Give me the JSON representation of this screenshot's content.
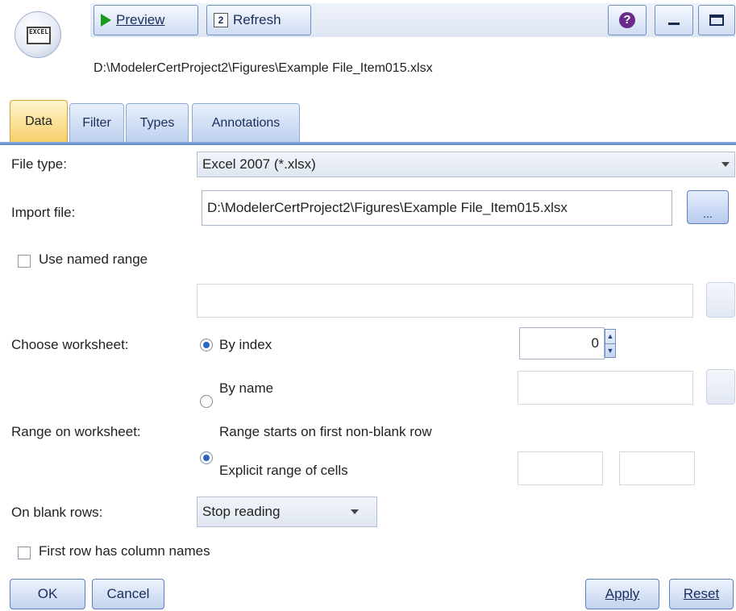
{
  "header": {
    "node_icon_text": "EXCEL",
    "preview_label": "Preview",
    "refresh_label": "Refresh",
    "help_label": "?",
    "file_path": "D:\\ModelerCertProject2\\Figures\\Example File_Item015.xlsx"
  },
  "tabs": [
    {
      "label": "Data",
      "active": true
    },
    {
      "label": "Filter",
      "active": false
    },
    {
      "label": "Types",
      "active": false
    },
    {
      "label": "Annotations",
      "active": false
    }
  ],
  "form": {
    "file_type_label": "File type:",
    "file_type_value": "Excel 2007 (*.xlsx)",
    "import_file_label": "Import file:",
    "import_file_value": "D:\\ModelerCertProject2\\Figures\\Example File_Item015.xlsx",
    "browse_label": "...",
    "use_named_range_label": "Use named range",
    "named_range_value": "",
    "choose_worksheet_label": "Choose worksheet:",
    "by_index_label": "By index",
    "index_value": "0",
    "by_name_label": "By name",
    "worksheet_name_value": "",
    "range_label": "Range on worksheet:",
    "range_first_nonblank_label": "Range starts on first non-blank row",
    "explicit_range_label": "Explicit range of cells",
    "range_from_value": "",
    "range_to_value": "",
    "blank_rows_label": "On blank rows:",
    "blank_rows_value": "Stop reading",
    "first_row_names_label": "First row has column names"
  },
  "footer": {
    "ok_label": "OK",
    "cancel_label": "Cancel",
    "apply_label": "Apply",
    "reset_label": "Reset"
  },
  "colors": {
    "accent": "#2b63c6",
    "tab_active": "#f6cf6a",
    "button_border": "#5b7fc0"
  }
}
